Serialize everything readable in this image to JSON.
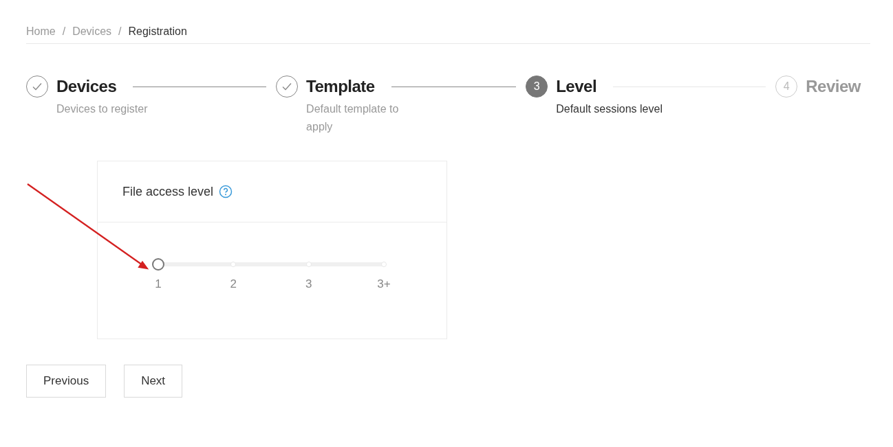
{
  "breadcrumb": {
    "separator": "/",
    "items": [
      {
        "label": "Home",
        "current": false
      },
      {
        "label": "Devices",
        "current": false
      },
      {
        "label": "Registration",
        "current": true
      }
    ]
  },
  "steps": [
    {
      "title": "Devices",
      "description": "Devices to register",
      "done": true,
      "active": false
    },
    {
      "title": "Template",
      "description": "Default template to apply",
      "done": true,
      "active": false
    },
    {
      "number": "3",
      "title": "Level",
      "description": "Default sessions level",
      "done": false,
      "active": true
    },
    {
      "number": "4",
      "title": "Review",
      "done": false,
      "active": false
    }
  ],
  "card": {
    "title": "File access level",
    "slider": {
      "level": 0,
      "marks": [
        "1",
        "2",
        "3",
        "3+"
      ]
    }
  },
  "buttons": [
    "Previous",
    "Next"
  ]
}
